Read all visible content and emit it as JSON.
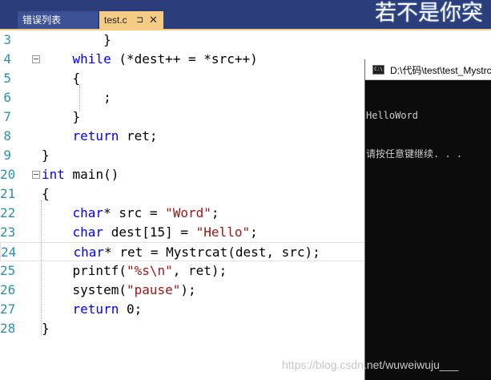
{
  "tabs": {
    "errors_label": "错误列表",
    "active_label": "test.c",
    "pin_glyph": "⊐",
    "close_glyph": "✕"
  },
  "header_text": "若不是你突",
  "editor": {
    "lines": [
      {
        "num": "3",
        "fold": false,
        "tokens": [
          {
            "t": "        }",
            "c": ""
          }
        ]
      },
      {
        "num": "4",
        "fold": true,
        "tokens": [
          {
            "t": "    ",
            "c": ""
          },
          {
            "t": "while",
            "c": "kw"
          },
          {
            "t": " (*dest++ = *src++)",
            "c": ""
          }
        ]
      },
      {
        "num": "5",
        "fold": false,
        "tokens": [
          {
            "t": "    {",
            "c": ""
          }
        ]
      },
      {
        "num": "6",
        "fold": false,
        "tokens": [
          {
            "t": "        ;",
            "c": ""
          }
        ]
      },
      {
        "num": "7",
        "fold": false,
        "tokens": [
          {
            "t": "    }",
            "c": ""
          }
        ]
      },
      {
        "num": "8",
        "fold": false,
        "tokens": [
          {
            "t": "    ",
            "c": ""
          },
          {
            "t": "return",
            "c": "kw"
          },
          {
            "t": " ret;",
            "c": ""
          }
        ]
      },
      {
        "num": "9",
        "fold": false,
        "tokens": [
          {
            "t": "}",
            "c": ""
          }
        ]
      },
      {
        "num": "20",
        "fold": true,
        "tokens": [
          {
            "t": "int",
            "c": "kw"
          },
          {
            "t": " main()",
            "c": ""
          }
        ]
      },
      {
        "num": "21",
        "fold": false,
        "tokens": [
          {
            "t": "{",
            "c": ""
          }
        ]
      },
      {
        "num": "22",
        "fold": false,
        "tokens": [
          {
            "t": "    ",
            "c": ""
          },
          {
            "t": "char",
            "c": "kw"
          },
          {
            "t": "* src = ",
            "c": ""
          },
          {
            "t": "\"Word\"",
            "c": "str"
          },
          {
            "t": ";",
            "c": ""
          }
        ]
      },
      {
        "num": "23",
        "fold": false,
        "tokens": [
          {
            "t": "    ",
            "c": ""
          },
          {
            "t": "char",
            "c": "kw"
          },
          {
            "t": " dest[15] = ",
            "c": ""
          },
          {
            "t": "\"Hello\"",
            "c": "str"
          },
          {
            "t": ";",
            "c": ""
          }
        ]
      },
      {
        "num": "24",
        "fold": false,
        "current": true,
        "tokens": [
          {
            "t": "    ",
            "c": ""
          },
          {
            "t": "char",
            "c": "kw"
          },
          {
            "t": "* ret = Mystrcat(dest, src);",
            "c": ""
          }
        ]
      },
      {
        "num": "25",
        "fold": false,
        "tokens": [
          {
            "t": "    printf(",
            "c": ""
          },
          {
            "t": "\"%s\\n\"",
            "c": "str"
          },
          {
            "t": ", ret);",
            "c": ""
          }
        ]
      },
      {
        "num": "26",
        "fold": false,
        "tokens": [
          {
            "t": "    system(",
            "c": ""
          },
          {
            "t": "\"pause\"",
            "c": "str"
          },
          {
            "t": ");",
            "c": ""
          }
        ]
      },
      {
        "num": "27",
        "fold": false,
        "tokens": [
          {
            "t": "    ",
            "c": ""
          },
          {
            "t": "return",
            "c": "kw"
          },
          {
            "t": " 0;",
            "c": ""
          }
        ]
      },
      {
        "num": "28",
        "fold": false,
        "tokens": [
          {
            "t": "}",
            "c": ""
          }
        ]
      }
    ]
  },
  "console": {
    "title": "D:\\代码\\test\\test_Mystrcat",
    "icon_text": "C:\\",
    "output": [
      "HelloWord",
      "请按任意键继续. . ."
    ]
  },
  "watermark": "https://blog.csdn.net/wuweiwuju___",
  "colors": {
    "tabbar": "#2b3d7a",
    "active_tab": "#f5cc84",
    "keyword": "#0000ff",
    "string": "#a31515",
    "line_number": "#2b91af",
    "console_bg": "#0c0c0c"
  }
}
